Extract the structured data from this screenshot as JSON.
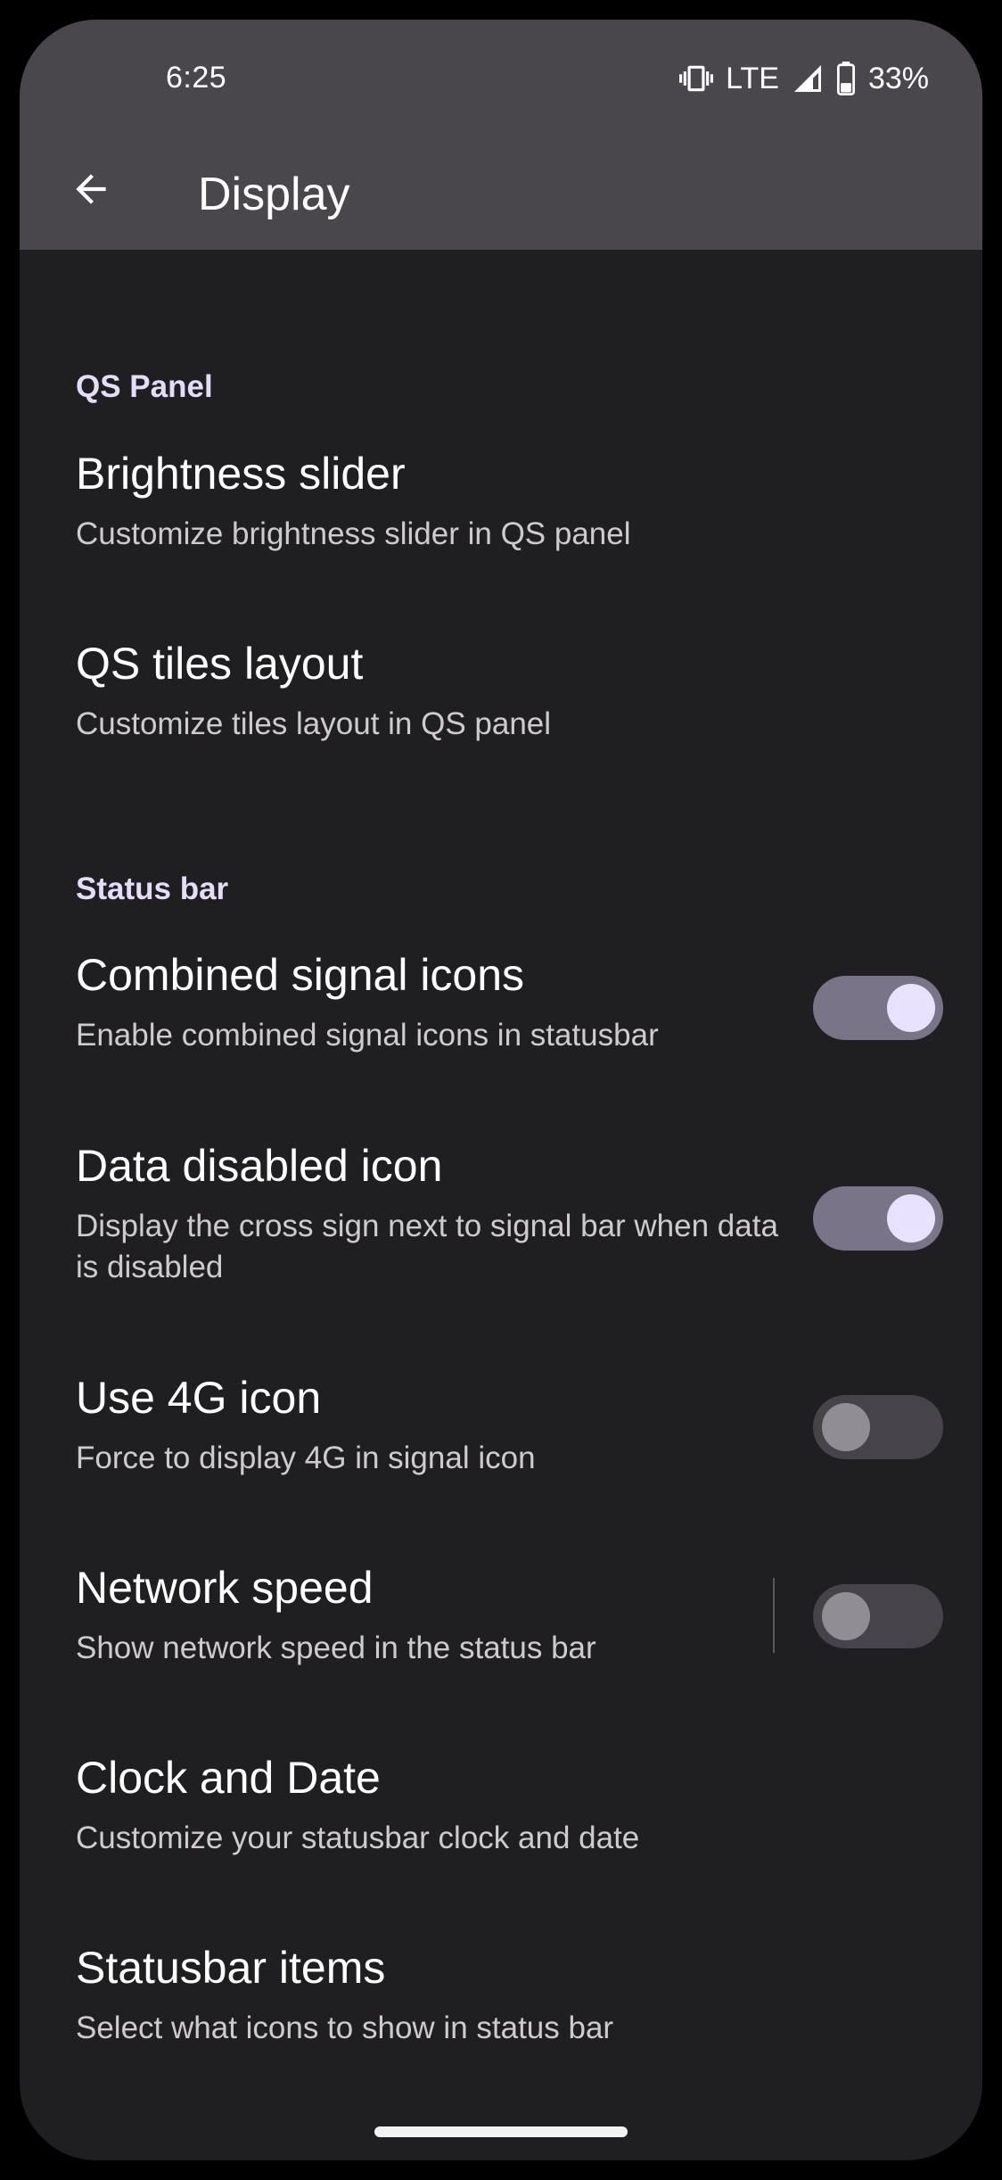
{
  "status_bar": {
    "time": "6:25",
    "network": "LTE",
    "battery": "33%",
    "icons": [
      "vibrate-icon",
      "signal-icon",
      "battery-icon"
    ]
  },
  "app_bar": {
    "title": "Display",
    "back_icon": "arrow-back-icon"
  },
  "sections": [
    {
      "header": "QS Panel",
      "items": [
        {
          "title": "Brightness slider",
          "subtitle": "Customize brightness slider in QS panel"
        },
        {
          "title": "QS tiles layout",
          "subtitle": "Customize tiles layout in QS panel"
        }
      ]
    },
    {
      "header": "Status bar",
      "items": [
        {
          "title": "Combined signal icons",
          "subtitle": "Enable combined signal icons in statusbar",
          "toggle": true
        },
        {
          "title": "Data disabled icon",
          "subtitle": "Display the cross sign next to signal bar when data is disabled",
          "toggle": true
        },
        {
          "title": "Use 4G icon",
          "subtitle": "Force to display 4G in signal icon",
          "toggle": false
        },
        {
          "title": "Network speed",
          "subtitle": "Show network speed in the status bar",
          "toggle": false
        },
        {
          "title": "Clock and Date",
          "subtitle": "Customize your statusbar clock and date"
        },
        {
          "title": "Statusbar items",
          "subtitle": "Select what icons to show in status bar"
        }
      ]
    }
  ],
  "colors": {
    "background": "#1f1f21",
    "app_bar": "#4a474c",
    "accent_header": "#e5dcf8",
    "toggle_on_track": "#7a7489",
    "toggle_on_knob": "#e9e2ff",
    "toggle_off_track": "#46444a",
    "toggle_off_knob": "#908d94"
  }
}
